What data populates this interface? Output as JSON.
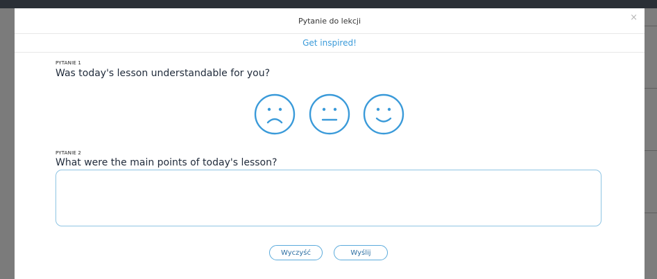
{
  "modal": {
    "title": "Pytanie do lekcji",
    "close_glyph": "×",
    "inspire_link": "Get inspired!"
  },
  "questions": [
    {
      "label": "PYTANIE 1",
      "text": "Was today's lesson understandable for you?"
    },
    {
      "label": "PYTANIE 2",
      "text": "What were the main points of today's lesson?"
    }
  ],
  "smileys": [
    "sad-face-icon",
    "neutral-face-icon",
    "happy-face-icon"
  ],
  "answer": {
    "value": "",
    "placeholder": ""
  },
  "buttons": {
    "clear": "Wyczyść",
    "send": "Wyślij"
  },
  "colors": {
    "accent": "#3a9ad9",
    "smiley": "#3a9ad9",
    "border": "#8ec4e3"
  }
}
